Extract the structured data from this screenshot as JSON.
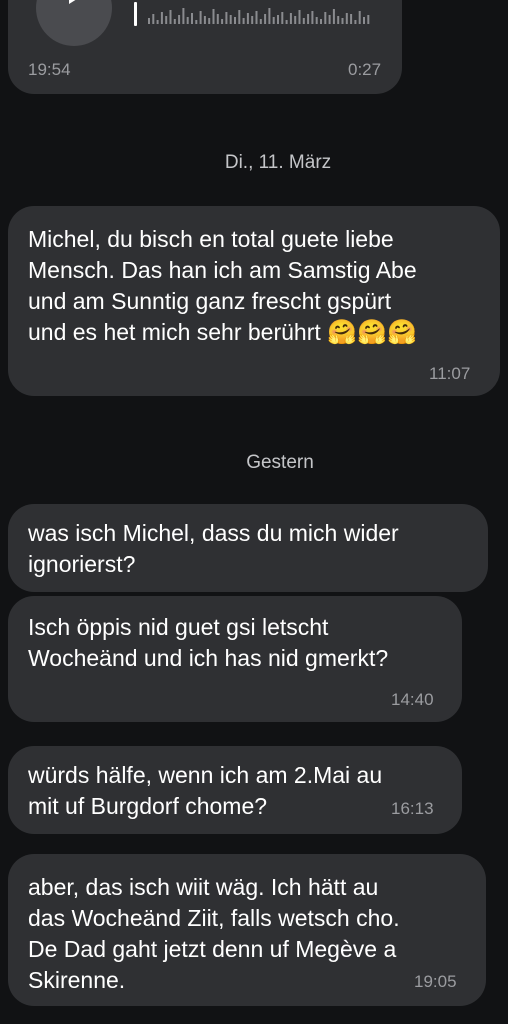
{
  "voice_message": {
    "time": "19:54",
    "duration": "0:27",
    "icon": "play-icon"
  },
  "separators": {
    "date1": "Di., 11. März",
    "date2": "Gestern"
  },
  "messages": [
    {
      "text": "Michel, du bisch en total guete liebe\nMensch. Das han ich am Samstig Abe\nund am Sunntig ganz frescht gspürt\nund es het mich sehr berührt ",
      "emoji": "🤗🤗🤗",
      "time": "11:07"
    },
    {
      "text": "was isch Michel, dass du mich wider\nignorierst?",
      "time": ""
    },
    {
      "text": "Isch öppis nid guet gsi letscht\nWocheänd und ich has nid gmerkt?",
      "time": "14:40"
    },
    {
      "text": "würds hälfe, wenn ich am 2.Mai au\nmit uf Burgdorf chome?",
      "time": "16:13"
    },
    {
      "text": "aber, das isch wiit wäg. Ich hätt au\ndas Wocheänd Ziit, falls wetsch cho.\nDe Dad gaht jetzt denn uf Megève a\nSkirenne.",
      "time": "19:05"
    }
  ],
  "colors": {
    "background": "#111214",
    "bubble": "#2f3033",
    "timestamp": "#9b9ca0"
  }
}
